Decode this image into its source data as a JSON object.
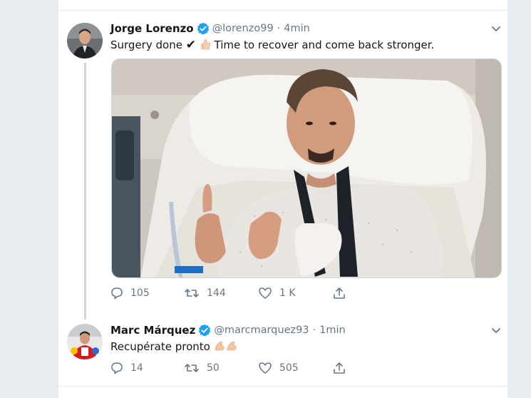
{
  "tweet1": {
    "name": "Jorge Lorenzo",
    "handle": "@lorenzo99",
    "separator": "·",
    "time": "4min",
    "text_prefix": "Surgery done",
    "check": "✔",
    "text_suffix": "Time to recover and come back stronger.",
    "replies": "105",
    "retweets": "144",
    "likes": "1 K"
  },
  "tweet2": {
    "name": "Marc Márquez",
    "handle": "@marcmarquez93",
    "separator": "·",
    "time": "1min",
    "text": "Recupérate pronto",
    "replies": "14",
    "retweets": "50",
    "likes": "505"
  },
  "icons": {
    "verified": "verified-badge",
    "caret": "chevron-down",
    "reply": "comment",
    "retweet": "retweet",
    "like": "heart",
    "share": "share"
  },
  "colors": {
    "accent": "#1da1f2",
    "muted": "#657786",
    "border": "#e6ecf0"
  }
}
